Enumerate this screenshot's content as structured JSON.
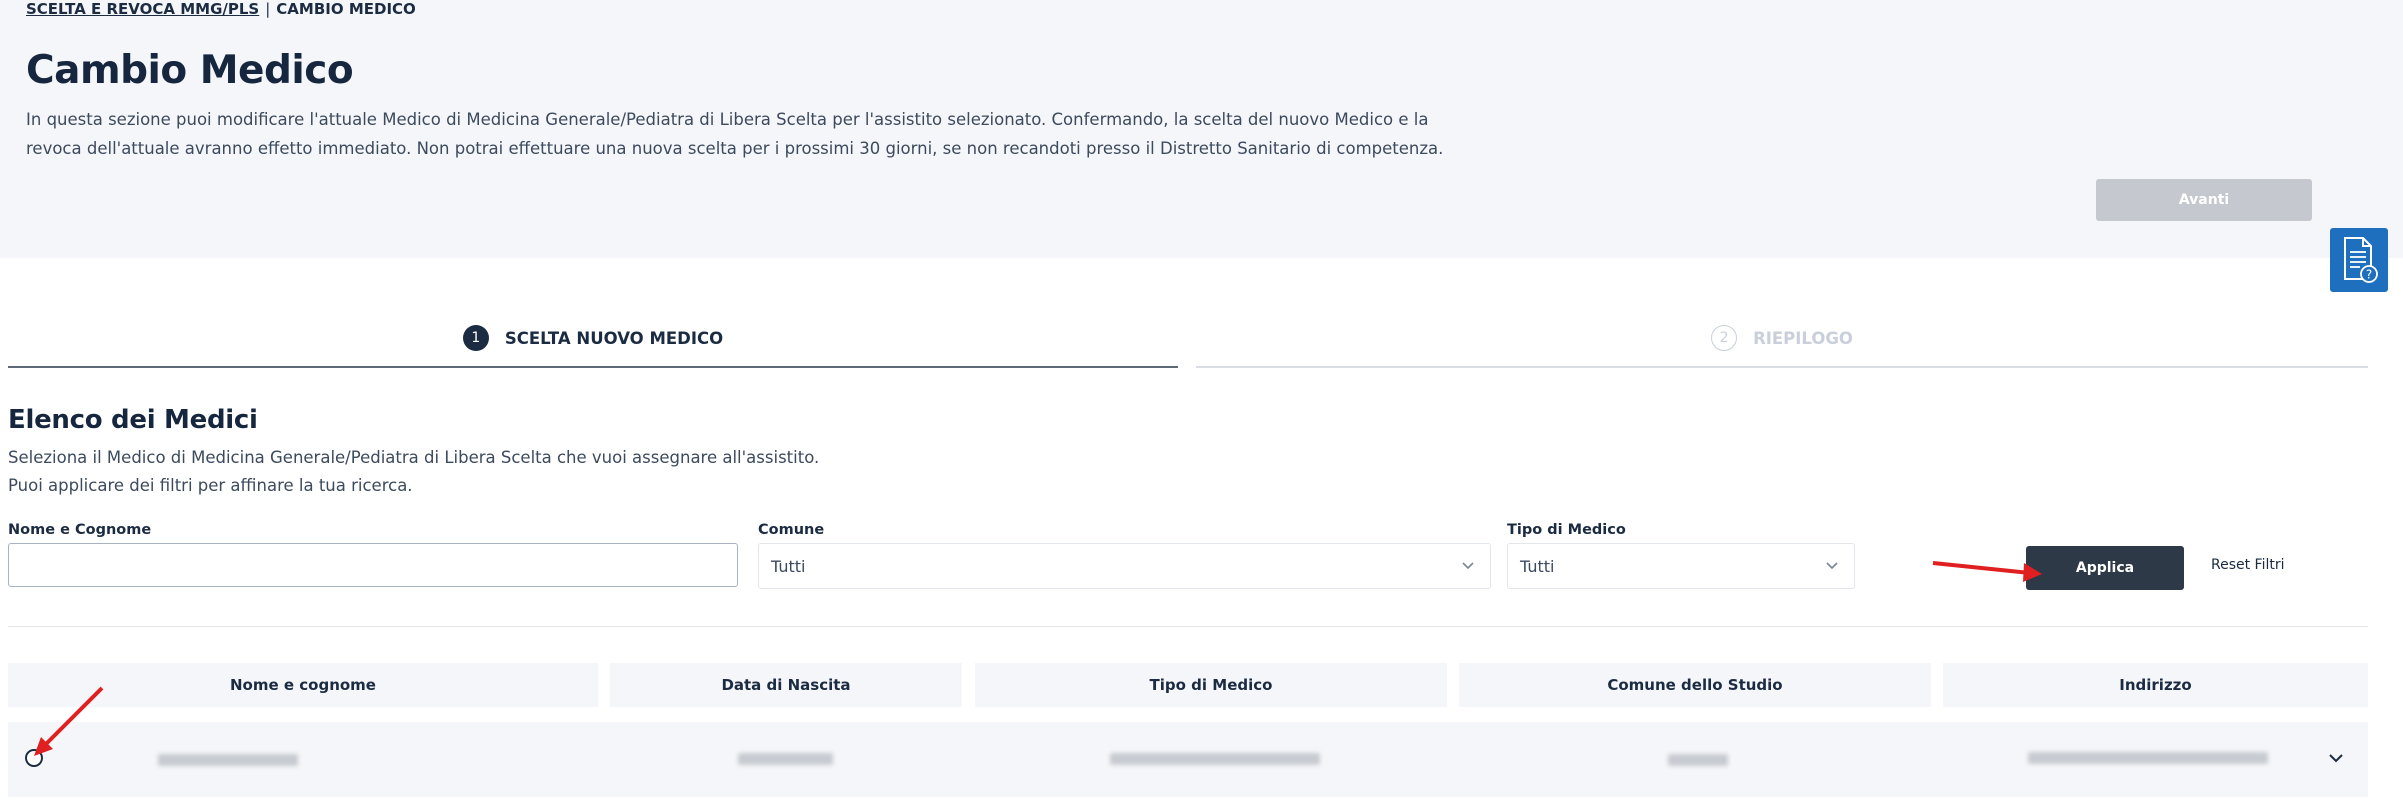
{
  "breadcrumb": {
    "parent": "SCELTA E REVOCA MMG/PLS",
    "separator": "|",
    "current": "CAMBIO MEDICO"
  },
  "page": {
    "title": "Cambio Medico",
    "description": "In questa sezione puoi modificare l'attuale Medico di Medicina Generale/Pediatra di Libera Scelta per l'assistito selezionato. Confermando, la scelta del nuovo Medico e la revoca dell'attuale avranno effetto immediato. Non potrai effettuare una nuova scelta per i prossimi 30 giorni, se non recandoti presso il Distretto Sanitario di competenza."
  },
  "actions": {
    "avanti_label": "Avanti"
  },
  "stepper": {
    "steps": [
      {
        "number": "1",
        "label": "SCELTA NUOVO MEDICO",
        "state": "active"
      },
      {
        "number": "2",
        "label": "RIEPILOGO",
        "state": "inactive"
      }
    ]
  },
  "doctors": {
    "title": "Elenco dei Medici",
    "description_line1": "Seleziona il Medico di Medicina Generale/Pediatra di Libera Scelta che vuoi assegnare all'assistito.",
    "description_line2": "Puoi applicare dei filtri per affinare la tua ricerca."
  },
  "filters": {
    "name_label": "Nome e Cognome",
    "name_value": "",
    "comune_label": "Comune",
    "comune_value": "Tutti",
    "tipo_label": "Tipo di Medico",
    "tipo_value": "Tutti",
    "apply_label": "Applica",
    "reset_label": "Reset Filtri"
  },
  "table": {
    "columns": [
      "Nome e cognome",
      "Data di Nascita",
      "Tipo di Medico",
      "Comune dello Studio",
      "Indirizzo"
    ],
    "rows": [
      {
        "selected": false,
        "content": "redacted"
      }
    ]
  },
  "icons": {
    "help": "document-help-icon",
    "chevron": "chevron-down-icon",
    "annotation": "red-arrow-icon"
  },
  "colors": {
    "primary_dark": "#2d3947",
    "help_button": "#1f6fbf",
    "disabled": "#c5c9cf",
    "annotation": "#e02020"
  }
}
